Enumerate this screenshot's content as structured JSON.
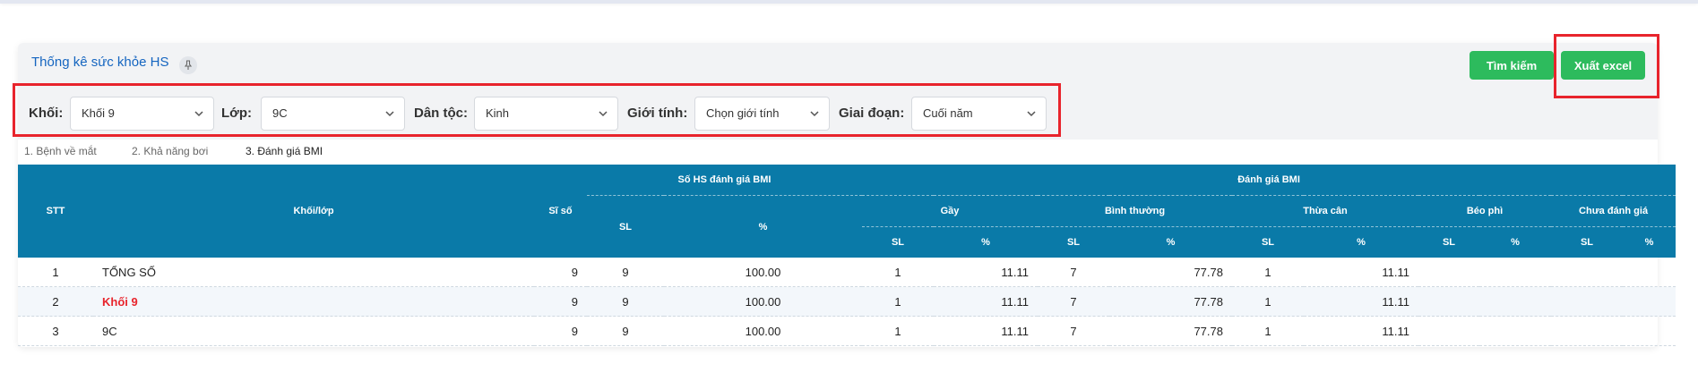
{
  "header": {
    "title": "Thống kê sức khỏe HS",
    "search_label": "Tìm kiếm",
    "export_label": "Xuất excel"
  },
  "filters": {
    "khoi": {
      "label": "Khối:",
      "value": "Khối 9"
    },
    "lop": {
      "label": "Lớp:",
      "value": "9C"
    },
    "dantoc": {
      "label": "Dân tộc:",
      "value": "Kinh"
    },
    "gioitinh": {
      "label": "Giới tính:",
      "value": "Chọn giới tính"
    },
    "giaidoan": {
      "label": "Giai đoạn:",
      "value": "Cuối năm"
    }
  },
  "tabs": [
    {
      "label": "1. Bệnh về mắt"
    },
    {
      "label": "2. Khả năng bơi"
    },
    {
      "label": "3. Đánh giá BMI"
    }
  ],
  "table": {
    "h_stt": "STT",
    "h_khoilop": "Khối/lớp",
    "h_siso": "Sĩ số",
    "h_so_hs": "Số HS đánh giá BMI",
    "h_danh_gia": "Đánh giá BMI",
    "h_gay": "Gầy",
    "h_binh_thuong": "Bình thường",
    "h_thua_can": "Thừa cân",
    "h_beo_phi": "Béo phì",
    "h_chua": "Chưa đánh giá",
    "h_sl": "SL",
    "h_pct": "%",
    "rows": [
      {
        "stt": "1",
        "name": "TỔNG SỐ",
        "siso": "9",
        "sl": "9",
        "pct": "100.00",
        "gay_sl": "1",
        "gay_pct": "11.11",
        "bt_sl": "7",
        "bt_pct": "77.78",
        "tc_sl": "1",
        "tc_pct": "11.11"
      },
      {
        "stt": "2",
        "name": "Khối 9",
        "siso": "9",
        "sl": "9",
        "pct": "100.00",
        "gay_sl": "1",
        "gay_pct": "11.11",
        "bt_sl": "7",
        "bt_pct": "77.78",
        "tc_sl": "1",
        "tc_pct": "11.11"
      },
      {
        "stt": "3",
        "name": "9C",
        "siso": "9",
        "sl": "9",
        "pct": "100.00",
        "gay_sl": "1",
        "gay_pct": "11.11",
        "bt_sl": "7",
        "bt_pct": "77.78",
        "tc_sl": "1",
        "tc_pct": "11.11"
      }
    ]
  },
  "colors": {
    "accent_green": "#2dbb5d",
    "table_header": "#0a7aa8",
    "highlight_red": "#e8242c",
    "title_blue": "#1565c0"
  }
}
